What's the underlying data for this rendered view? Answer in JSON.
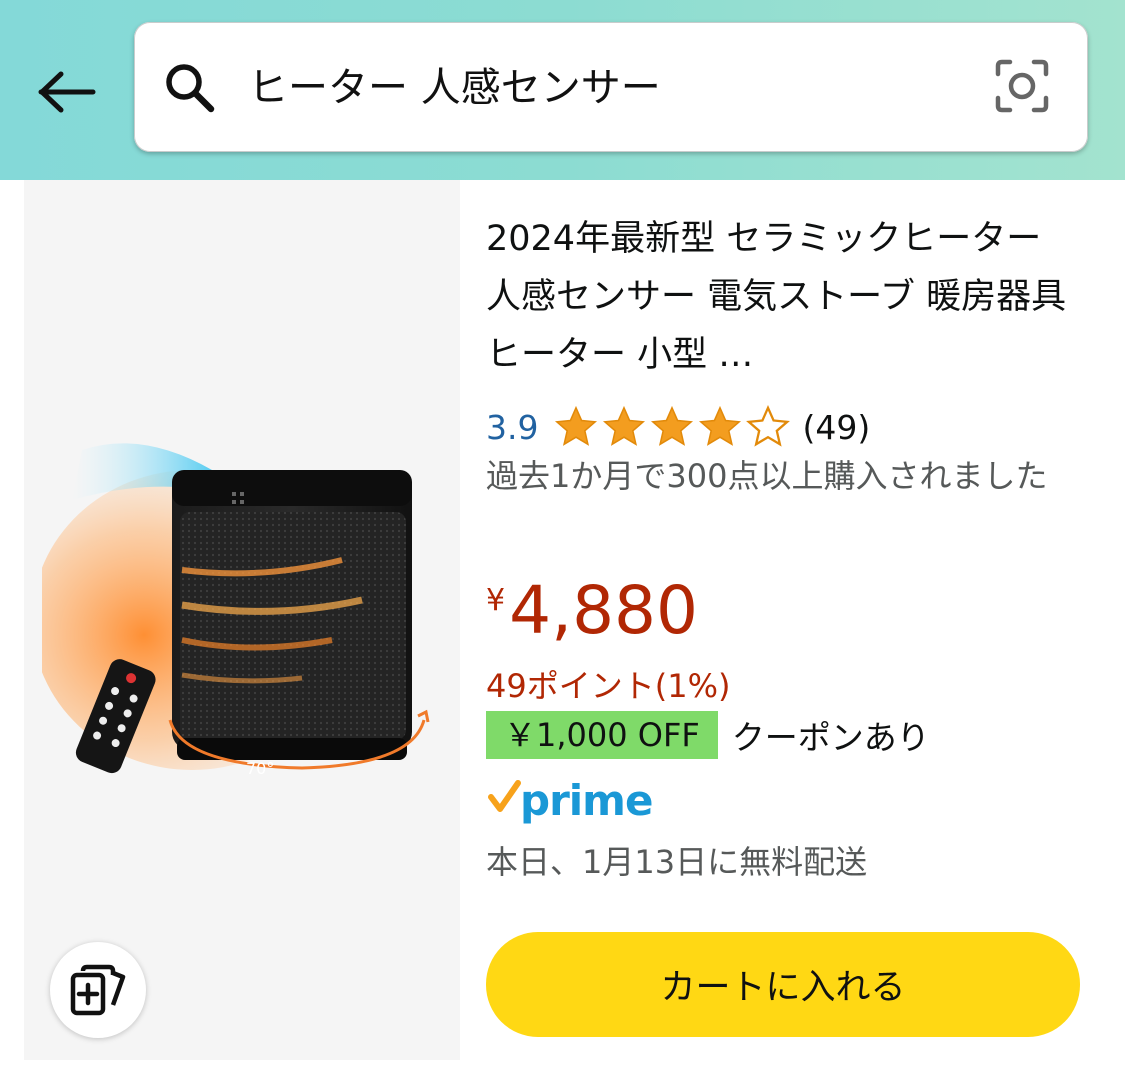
{
  "header": {
    "back_icon": "arrow-left-icon",
    "search_query": "ヒーター 人感センサー",
    "search_icon": "search-icon",
    "camera_icon": "camera-lens-icon",
    "gradient_colors": [
      "#84d9d8",
      "#a3e3cf"
    ]
  },
  "product": {
    "title": "2024年最新型 セラミックヒーター 人感センサー 電気ストーブ 暖房器具 ヒーター 小型 …",
    "rating": {
      "value": "3.9",
      "stars_filled": 3.9,
      "stars_total": 5,
      "count": "(49)"
    },
    "bought_text": "過去1か月で300点以上購入されました",
    "price": {
      "symbol": "¥",
      "value": "4,880",
      "color": "#b12704"
    },
    "points": "49ポイント(1%)",
    "coupon": {
      "badge": "￥1,000 OFF",
      "text": "クーポンあり",
      "badge_color": "#7fda69"
    },
    "prime_text": "prime",
    "delivery": "本日、1月13日に無料配送",
    "cart_button": "カートに入れる",
    "cart_button_color": "#ffd814",
    "image_label": "70°",
    "compare_icon": "add-to-compare-icon"
  }
}
